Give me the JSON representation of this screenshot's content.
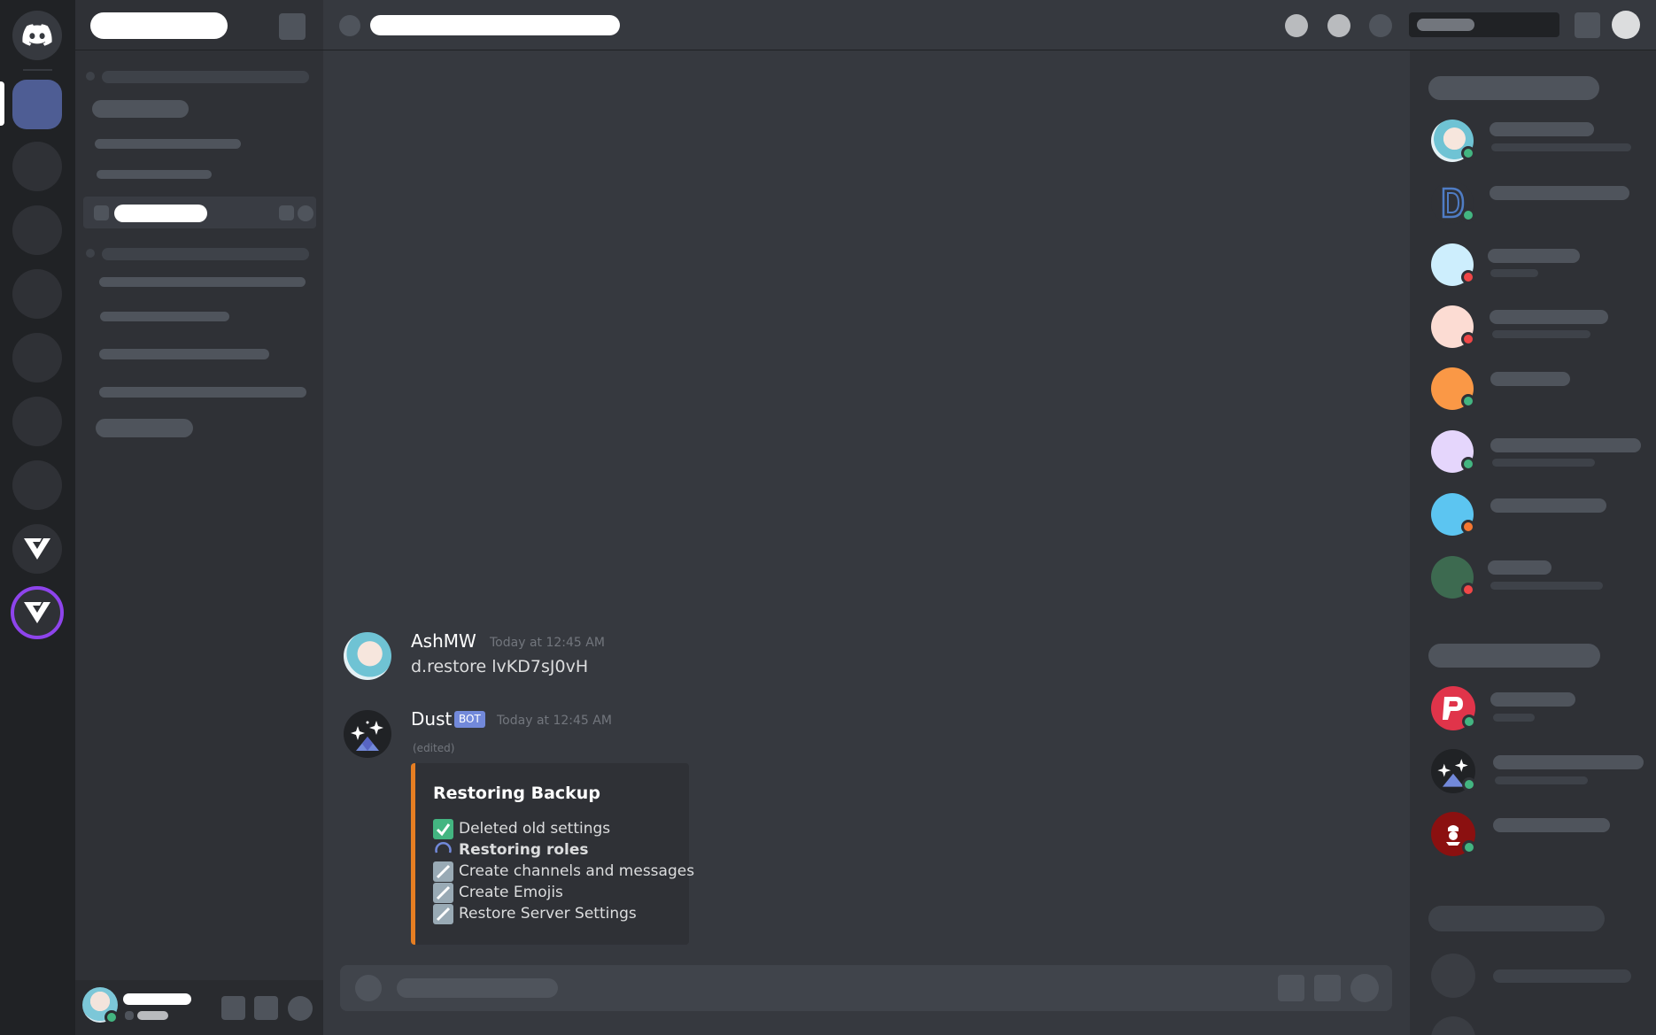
{
  "colors": {
    "accent": "#7289da",
    "bot_badge": "#7289da",
    "embed_border": "#e67e22",
    "online": "#43b581",
    "dnd": "#f04747",
    "idle": "#faa61a",
    "check": "#43b581"
  },
  "messages": [
    {
      "author": "AshMW",
      "timestamp": "Today at 12:45 AM",
      "text": "d.restore lvKD7sJ0vH"
    },
    {
      "author": "Dust",
      "badge": "BOT",
      "timestamp": "Today at 12:45 AM",
      "edited": "(edited)",
      "embed": {
        "title": "Restoring Backup",
        "items": [
          {
            "label": "Deleted old settings",
            "state": "done",
            "icon": "check-icon"
          },
          {
            "label": "Restoring roles",
            "state": "in-progress",
            "icon": "spinner-icon"
          },
          {
            "label": "Create channels and messages",
            "state": "pending",
            "icon": "pencil-icon"
          },
          {
            "label": "Create Emojis",
            "state": "pending",
            "icon": "pencil-icon"
          },
          {
            "label": "Restore Server Settings",
            "state": "pending",
            "icon": "pencil-icon"
          }
        ]
      }
    }
  ],
  "icons": {
    "home": "discord-logo-icon",
    "server_v1": "v-logo-icon",
    "server_v2": "v-logo-icon"
  }
}
